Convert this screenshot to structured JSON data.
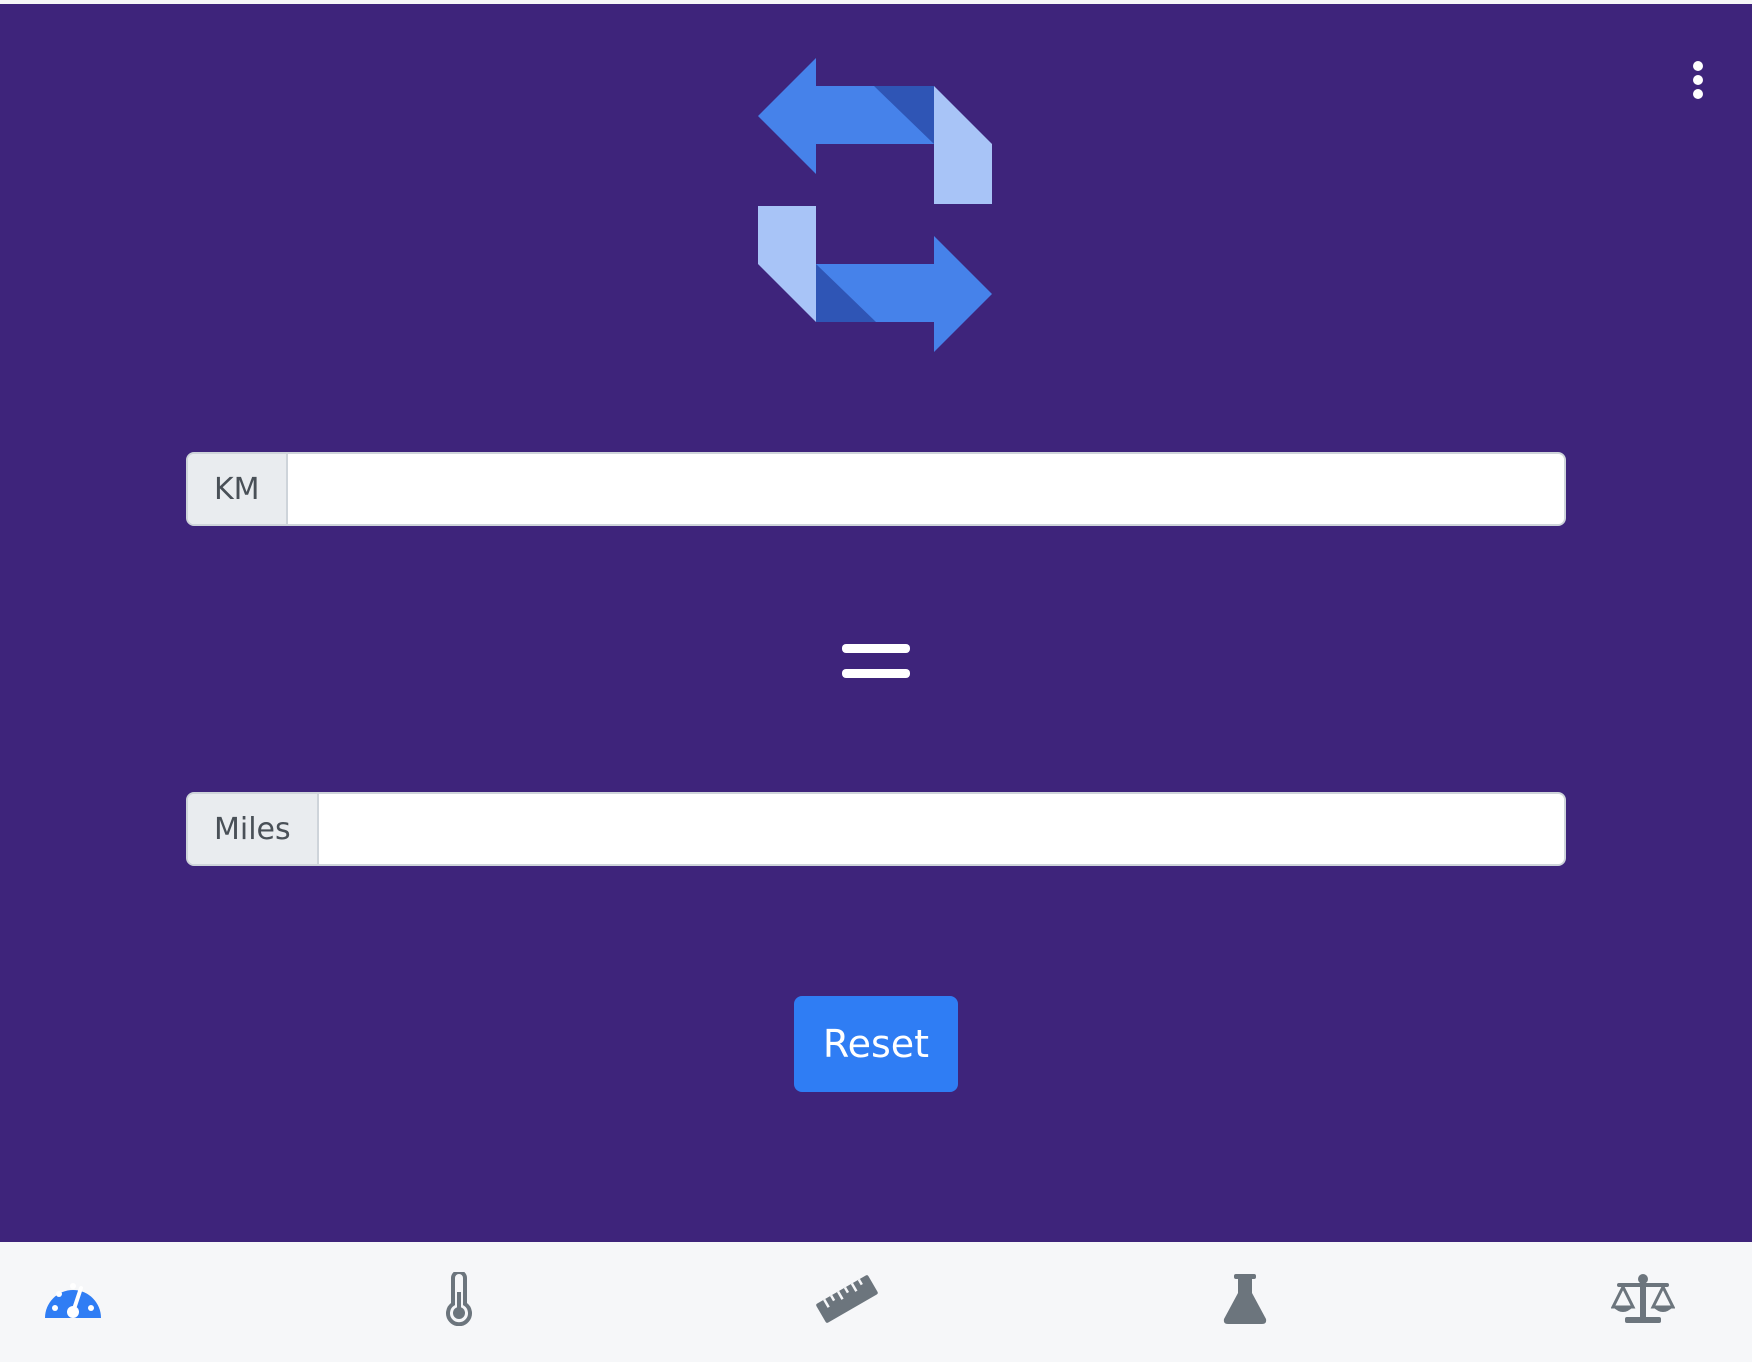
{
  "window": {
    "menu_icon": "more-vertical-icon"
  },
  "logo": {
    "icon": "convert-arrows-logo",
    "colors": {
      "primary": "#4682ea",
      "dark": "#2f55b5",
      "light": "#a8c4f7"
    }
  },
  "converter": {
    "from_label": "KM",
    "from_value": "",
    "from_placeholder": "",
    "equals_icon": "equals-icon",
    "to_label": "Miles",
    "to_value": "",
    "to_placeholder": "",
    "reset_label": "Reset"
  },
  "bottom_nav": {
    "items": [
      {
        "icon": "speedometer-icon",
        "active": true
      },
      {
        "icon": "thermometer-icon",
        "active": false
      },
      {
        "icon": "ruler-icon",
        "active": false
      },
      {
        "icon": "flask-icon",
        "active": false
      },
      {
        "icon": "balance-scale-icon",
        "active": false
      }
    ],
    "active_color": "#2f7df4",
    "inactive_color": "#6c757d"
  },
  "theme": {
    "background": "#3e247b",
    "button": "#2f7df4",
    "nav_background": "#f6f7f9"
  }
}
